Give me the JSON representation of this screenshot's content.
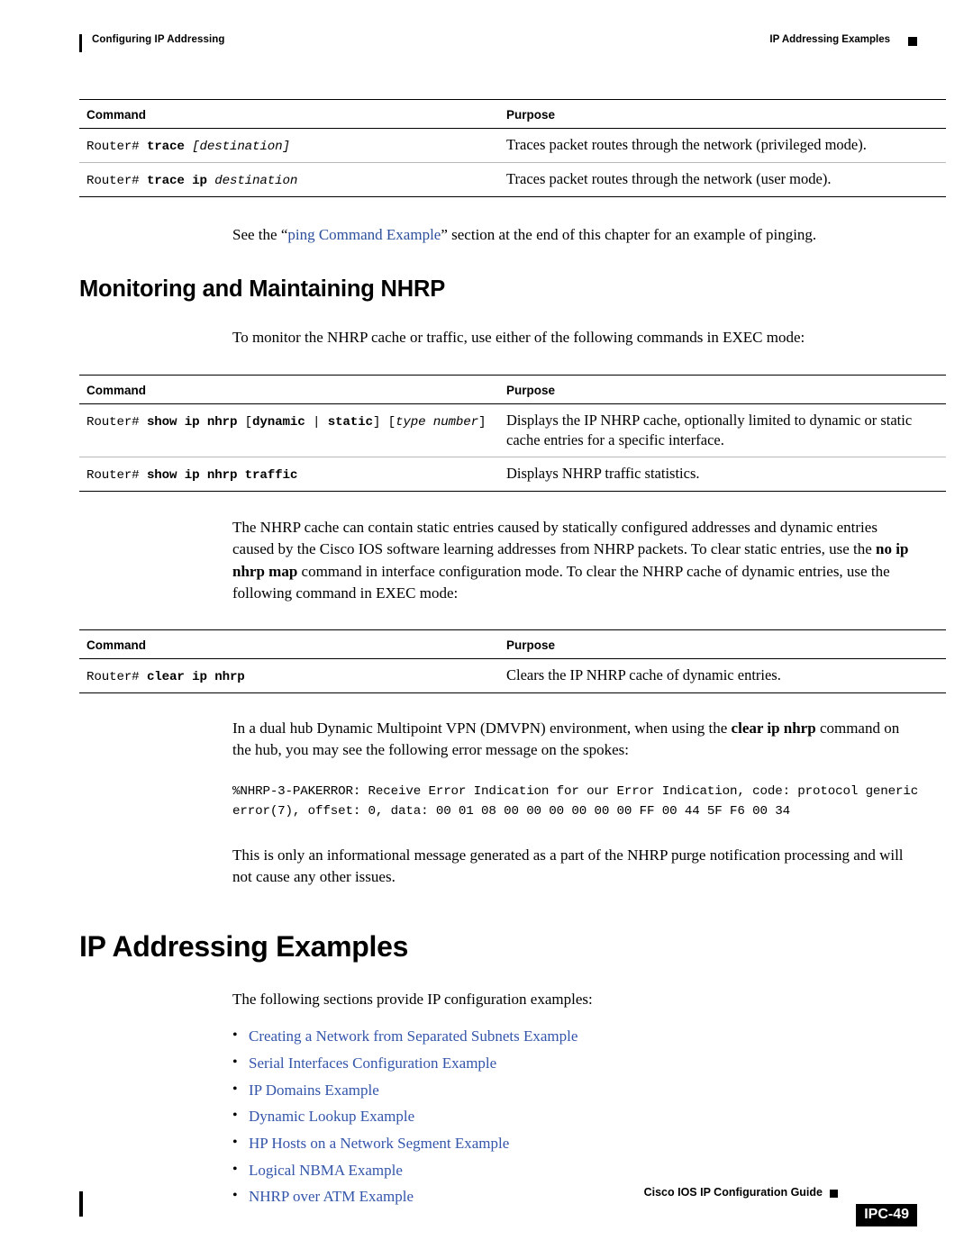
{
  "header": {
    "left": "Configuring IP Addressing",
    "right": "IP Addressing Examples"
  },
  "table1": {
    "headers": [
      "Command",
      "Purpose"
    ],
    "rows": [
      {
        "command_prefix": "Router#",
        "command_bold": "trace",
        "command_italic": " [destination]",
        "purpose": "Traces packet routes through the network (privileged mode)."
      },
      {
        "command_prefix": "Router#",
        "command_bold": "trace ip",
        "command_italic": " destination",
        "purpose": "Traces packet routes through the network (user mode)."
      }
    ]
  },
  "para_ping": {
    "before": "See the “",
    "link": "ping Command Example",
    "after": "” section at the end of this chapter for an example of pinging."
  },
  "heading_nhrp": "Monitoring and Maintaining NHRP",
  "para_monitor": "To monitor the NHRP cache or traffic, use either of the following commands in EXEC mode:",
  "table2": {
    "headers": [
      "Command",
      "Purpose"
    ],
    "rows": [
      {
        "command_prefix": "Router#",
        "command_bold": "show ip nhrp",
        "command_mid": " [",
        "command_bold2": "dynamic",
        "command_mid2": " | ",
        "command_bold3": "static",
        "command_mid3": "] [",
        "command_italic": "type number",
        "command_end": "]",
        "purpose": "Displays the IP NHRP cache, optionally limited to dynamic or static cache entries for a specific interface."
      },
      {
        "command_prefix": "Router#",
        "command_bold": "show ip nhrp traffic",
        "purpose": "Displays NHRP traffic statistics."
      }
    ]
  },
  "para_cache": {
    "part1": "The NHRP cache can contain static entries caused by statically configured addresses and dynamic entries caused by the Cisco IOS software learning addresses from NHRP packets. To clear static entries, use the ",
    "bold": "no ip nhrp map",
    "part2": " command in interface configuration mode. To clear the NHRP cache of dynamic entries, use the following command in EXEC mode:"
  },
  "table3": {
    "headers": [
      "Command",
      "Purpose"
    ],
    "rows": [
      {
        "command_prefix": "Router#",
        "command_bold": "clear ip nhrp",
        "purpose": "Clears the IP NHRP cache of dynamic entries."
      }
    ]
  },
  "para_dmvpn": {
    "part1": "In a dual hub Dynamic Multipoint VPN (DMVPN) environment, when using the ",
    "bold": "clear ip nhrp",
    "part2": " command on the hub, you may see the following error message on the spokes:"
  },
  "code_error": "%NHRP-3-PAKERROR: Receive Error Indication for our Error Indication, code: protocol generic error(7), offset: 0, data: 00 01 08 00 00 00 00 00 00 FF 00 44 5F F6 00 34",
  "para_info": "This is only an informational message generated as a part of the NHRP purge notification processing and will not cause any other issues.",
  "heading_examples": "IP Addressing Examples",
  "para_following": "The following sections provide IP configuration examples:",
  "example_links": [
    "Creating a Network from Separated Subnets Example",
    "Serial Interfaces Configuration Example",
    "IP Domains Example",
    "Dynamic Lookup Example",
    "HP Hosts on a Network Segment Example",
    "Logical NBMA Example",
    "NHRP over ATM Example"
  ],
  "footer": {
    "guide": "Cisco IOS IP Configuration Guide",
    "page": "IPC-49"
  },
  "colors": {
    "link": "#3355aa",
    "rule": "#000000"
  }
}
